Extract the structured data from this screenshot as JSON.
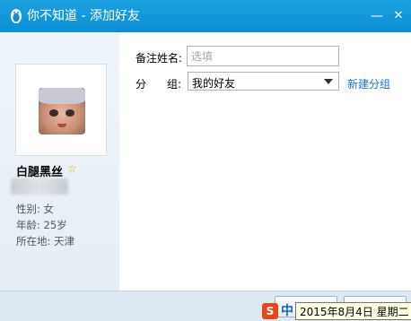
{
  "window": {
    "title": "你不知道 - 添加好友",
    "minimize_symbol": "—",
    "close_symbol": "✕",
    "app_icon": "qq-penguin-icon",
    "accent_color": "#1aa1e0"
  },
  "profile": {
    "nickname": "白腿黑丝",
    "star_symbol": "☆",
    "gender": "性别: 女",
    "age": "年龄: 25岁",
    "location": "所在地:  天津"
  },
  "form": {
    "remark_label": "备注姓名:",
    "remark_value": "",
    "remark_placeholder": "选填",
    "group_label_1": "分",
    "group_label_2": "组:",
    "group_selected": "我的好友",
    "new_group_link": "新建分组"
  },
  "taskbar": {
    "ime_s": "S",
    "ime_zh": "中",
    "date_tooltip": "2015年8月4日 星期二"
  }
}
